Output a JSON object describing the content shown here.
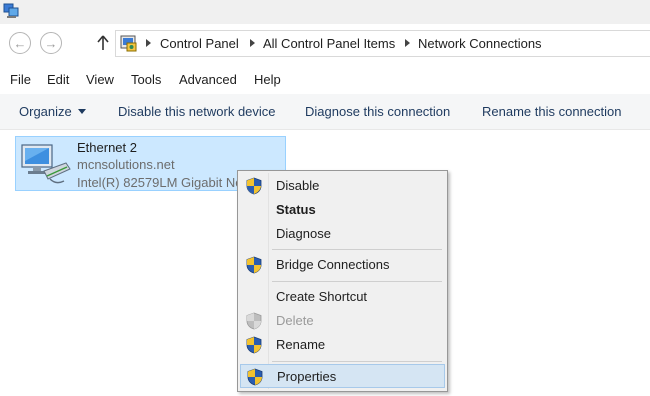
{
  "address": {
    "breadcrumb": [
      "Control Panel",
      "All Control Panel Items",
      "Network Connections"
    ]
  },
  "menubar": {
    "items": [
      "File",
      "Edit",
      "View",
      "Tools",
      "Advanced",
      "Help"
    ]
  },
  "commandbar": {
    "organize": "Organize",
    "items": [
      "Disable this network device",
      "Diagnose this connection",
      "Rename this connection"
    ]
  },
  "connection": {
    "name": "Ethernet 2",
    "domain": "mcnsolutions.net",
    "device": "Intel(R) 82579LM Gigabit Network Connection"
  },
  "context_menu": {
    "items": [
      {
        "label": "Disable",
        "shield": true,
        "state": "normal"
      },
      {
        "label": "Status",
        "shield": false,
        "state": "default"
      },
      {
        "label": "Diagnose",
        "shield": false,
        "state": "normal"
      },
      {
        "label": "Bridge Connections",
        "shield": true,
        "state": "normal"
      },
      {
        "label": "Create Shortcut",
        "shield": false,
        "state": "normal"
      },
      {
        "label": "Delete",
        "shield": true,
        "state": "disabled"
      },
      {
        "label": "Rename",
        "shield": true,
        "state": "normal"
      },
      {
        "label": "Properties",
        "shield": true,
        "state": "highlighted"
      }
    ]
  },
  "colors": {
    "selection_bg": "#cce8ff",
    "selection_border": "#99d1ff",
    "menu_bg": "#f0f0f0",
    "menu_highlight": "#d5e5f3"
  }
}
